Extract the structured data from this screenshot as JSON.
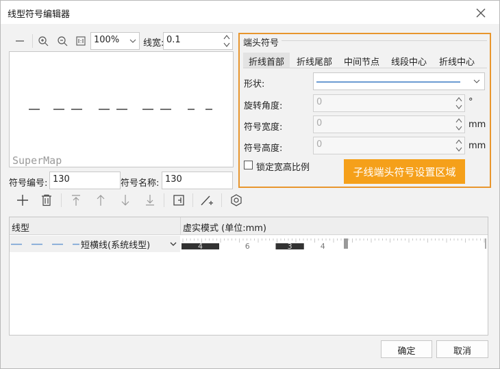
{
  "window": {
    "title": "线型符号编辑器"
  },
  "toolbar": {
    "zoom": "100%",
    "linewidth_label": "线宽:",
    "linewidth_value": "0.1"
  },
  "preview": {
    "watermark": "SuperMap"
  },
  "symbol": {
    "id_label": "符号编号:",
    "id_value": "130",
    "name_label": "符号名称:",
    "name_value": "130"
  },
  "endpoint": {
    "group_title": "端头符号",
    "tabs": [
      "折线首部",
      "折线尾部",
      "中间节点",
      "线段中心",
      "折线中心"
    ],
    "active_tab": 0,
    "shape_label": "形状:",
    "rotation_label": "旋转角度:",
    "rotation_value": "0",
    "rotation_unit": "°",
    "width_label": "符号宽度:",
    "width_value": "0",
    "width_unit": "mm",
    "height_label": "符号高度:",
    "height_value": "0",
    "height_unit": "mm",
    "lock_label": "锁定宽高比例",
    "highlight_note": "子线端头符号设置区域"
  },
  "table": {
    "col_linetype": "线型",
    "col_pattern": "虚实模式 (单位:mm)",
    "rows": [
      {
        "linetype": "短横线(系统线型)",
        "segments": [
          "4",
          "6",
          "3",
          "4"
        ]
      }
    ]
  },
  "buttons": {
    "ok": "确定",
    "cancel": "取消"
  },
  "colors": {
    "accent_border": "#e8952c",
    "highlight_bg": "#f5a01a",
    "shape_line": "#6b9bd2",
    "dash_solid": "#333333"
  }
}
